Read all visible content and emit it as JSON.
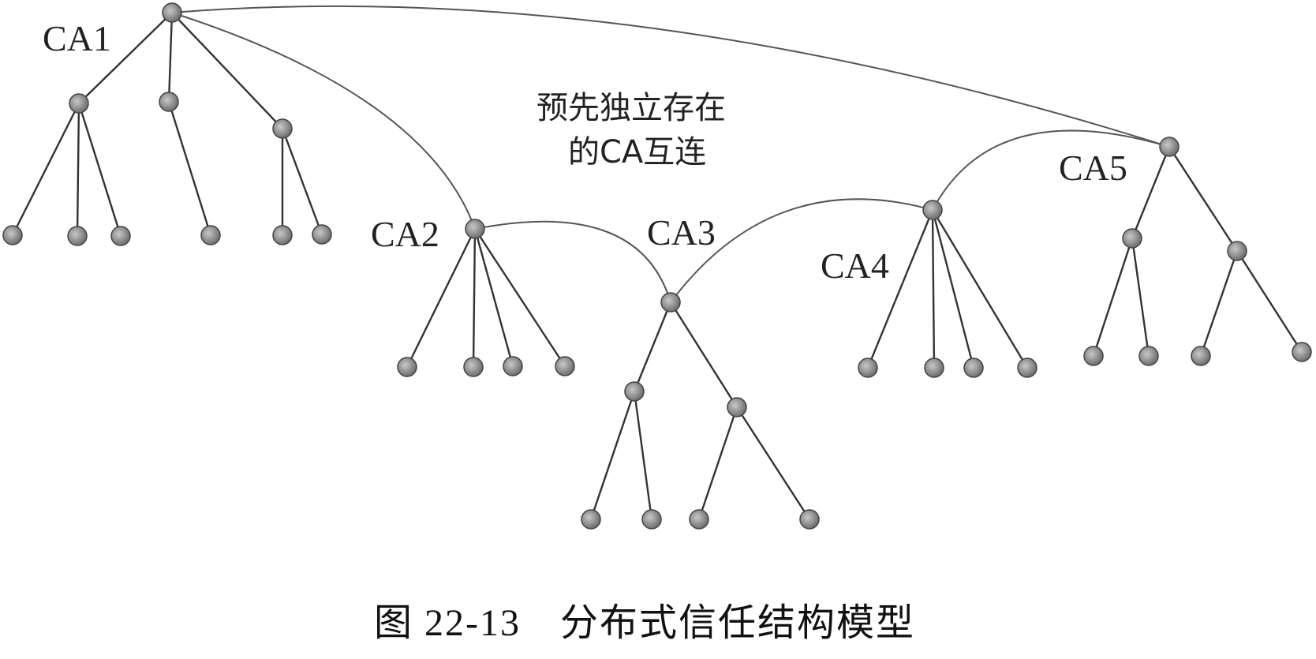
{
  "labels": {
    "ca1": "CA1",
    "ca2": "CA2",
    "ca3": "CA3",
    "ca4": "CA4",
    "ca5": "CA5"
  },
  "annotation": {
    "line1": "预先独立存在",
    "line2": "的CA互连"
  },
  "caption": "图 22-13　分布式信任结构模型"
}
